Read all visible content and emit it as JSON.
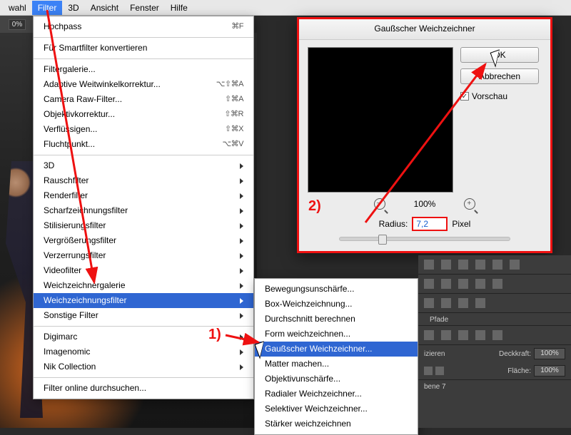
{
  "menubar": {
    "items": [
      "wahl",
      "Filter",
      "3D",
      "Ansicht",
      "Fenster",
      "Hilfe"
    ],
    "open_index": 1
  },
  "zoom": {
    "value": "0%"
  },
  "filter_menu": {
    "top": {
      "label": "Hochpass",
      "shortcut": "⌘F"
    },
    "smart": "Für Smartfilter konvertieren",
    "group1": [
      {
        "label": "Filtergalerie...",
        "shortcut": ""
      },
      {
        "label": "Adaptive Weitwinkelkorrektur...",
        "shortcut": "⌥⇧⌘A"
      },
      {
        "label": "Camera Raw-Filter...",
        "shortcut": "⇧⌘A"
      },
      {
        "label": "Objektivkorrektur...",
        "shortcut": "⇧⌘R"
      },
      {
        "label": "Verflüssigen...",
        "shortcut": "⇧⌘X"
      },
      {
        "label": "Fluchtpunkt...",
        "shortcut": "⌥⌘V"
      }
    ],
    "group2": [
      "3D",
      "Rauschfilter",
      "Renderfilter",
      "Scharfzeichnungsfilter",
      "Stilisierungsfilter",
      "Vergrößerungsfilter",
      "Verzerrungsfilter",
      "Videofilter",
      "Weichzeichnergalerie",
      "Weichzeichnungsfilter",
      "Sonstige Filter"
    ],
    "highlight_index": 9,
    "group3": [
      "Digimarc",
      "Imagenomic",
      "Nik Collection"
    ],
    "bottom": "Filter online durchsuchen..."
  },
  "submenu": {
    "items": [
      "Bewegungsunschärfe...",
      "Box-Weichzeichnung...",
      "Durchschnitt berechnen",
      "Form weichzeichnen...",
      "Gaußscher Weichzeichner...",
      "Matter machen...",
      "Objektivunschärfe...",
      "Radialer Weichzeichner...",
      "Selektiver Weichzeichner...",
      "Stärker weichzeichnen"
    ],
    "highlight_index": 4
  },
  "dialog": {
    "title": "Gaußscher Weichzeichner",
    "ok": "OK",
    "cancel": "Abbrechen",
    "preview_label": "Vorschau",
    "preview_checked": true,
    "zoom_pct": "100%",
    "radius_label": "Radius:",
    "radius_value": "7,2",
    "radius_unit": "Pixel"
  },
  "panels": {
    "tabs": [
      "",
      "Pfade"
    ],
    "mode_label": "izieren",
    "opacity_label": "Deckkraft:",
    "opacity_value": "100%",
    "fill_label": "Fläche:",
    "fill_value": "100%",
    "layer_name": "bene 7"
  },
  "annotations": {
    "step1": "1)",
    "step2": "2)"
  }
}
